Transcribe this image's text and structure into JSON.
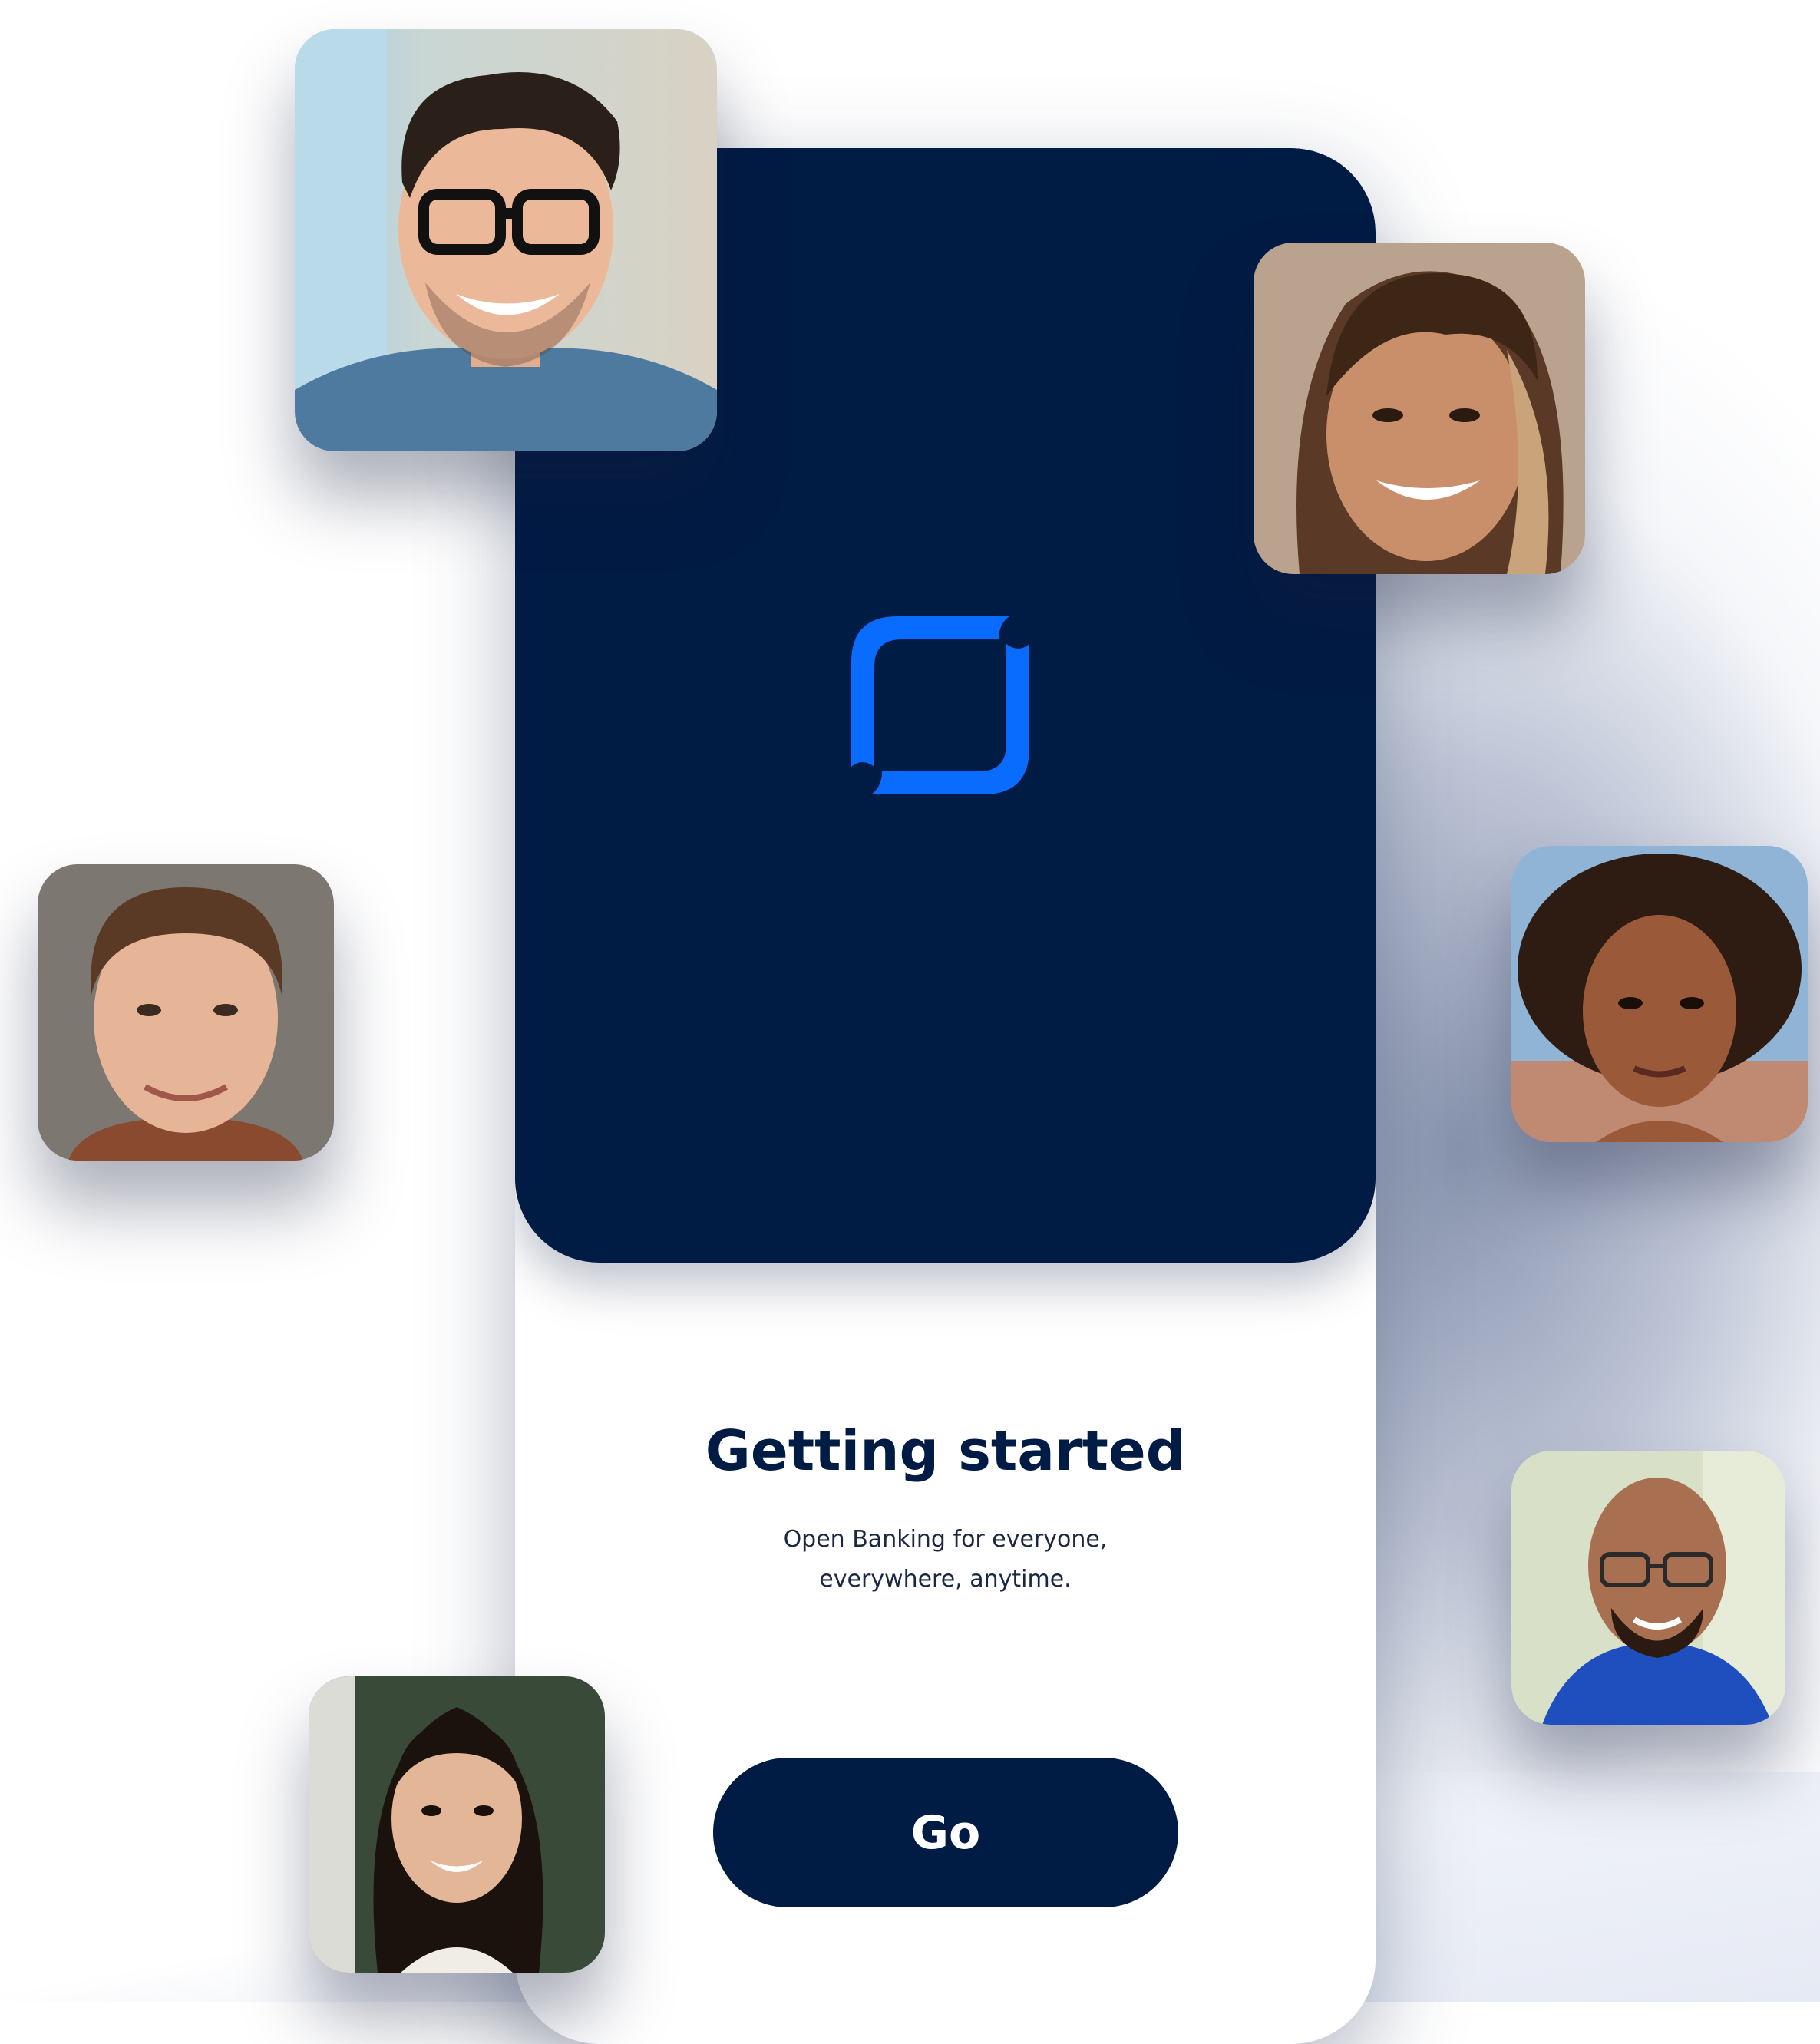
{
  "screen": {
    "title": "Getting started",
    "subtitle_line1": "Open Banking for everyone,",
    "subtitle_line2": "everywhere, anytime.",
    "go_label": "Go"
  },
  "logo": {
    "icon": "bracket-square-logo-icon",
    "color": "#0a6cff"
  },
  "colors": {
    "navy": "#001b44",
    "accent": "#0a6cff",
    "background": "#ffffff"
  },
  "avatars": [
    {
      "icon": "man-glasses-avatar"
    },
    {
      "icon": "woman-bangs-avatar"
    },
    {
      "icon": "man-smiling-avatar"
    },
    {
      "icon": "woman-curly-hair-avatar"
    },
    {
      "icon": "bald-man-glasses-avatar"
    },
    {
      "icon": "woman-long-hair-avatar"
    }
  ]
}
